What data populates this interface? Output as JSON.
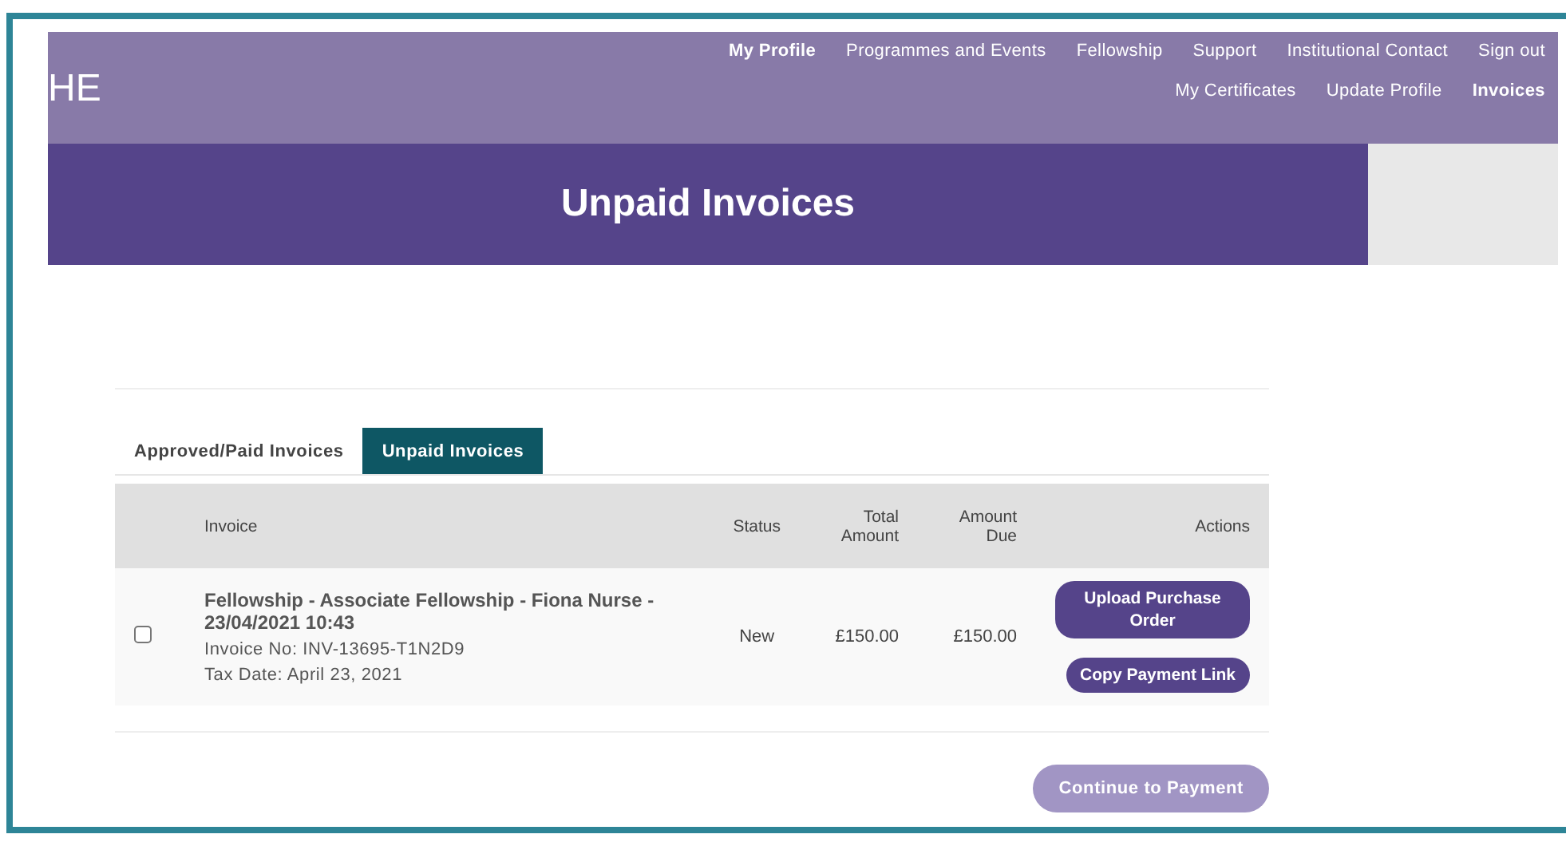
{
  "header": {
    "logo": "HE",
    "nav_primary": [
      {
        "label": "My Profile",
        "selected": true
      },
      {
        "label": "Programmes and Events",
        "selected": false
      },
      {
        "label": "Fellowship",
        "selected": false
      },
      {
        "label": "Support",
        "selected": false
      },
      {
        "label": "Institutional Contact",
        "selected": false
      },
      {
        "label": "Sign out",
        "selected": false
      }
    ],
    "nav_secondary": [
      {
        "label": "My Certificates",
        "selected": false
      },
      {
        "label": "Update Profile",
        "selected": false
      },
      {
        "label": "Invoices",
        "selected": true
      }
    ]
  },
  "banner": {
    "title": "Unpaid Invoices"
  },
  "tabs": [
    {
      "label": "Approved/Paid Invoices",
      "selected": false
    },
    {
      "label": "Unpaid Invoices",
      "selected": true
    }
  ],
  "table": {
    "columns": [
      "Invoice",
      "Status",
      "Total Amount",
      "Amount Due",
      "Actions"
    ],
    "rows": [
      {
        "checked": false,
        "title": "Fellowship - Associate Fellowship - Fiona Nurse - 23/04/2021 10:43",
        "invoice_no": "Invoice No: INV-13695-T1N2D9",
        "tax_date": "Tax Date: April 23, 2021",
        "status": "New",
        "total": "£150.00",
        "due": "£150.00",
        "actions": [
          "Upload Purchase Order",
          "Copy Payment Link"
        ]
      }
    ]
  },
  "continue_button": {
    "label": "Continue to Payment",
    "disabled": true
  }
}
